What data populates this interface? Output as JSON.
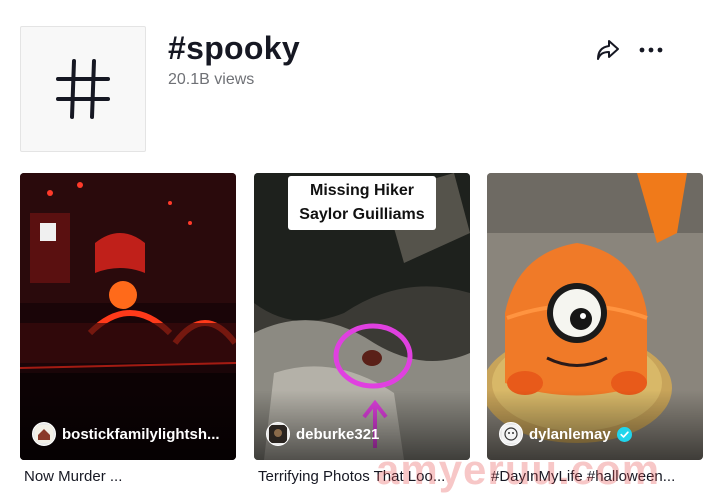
{
  "header": {
    "hashtag_symbol": "#",
    "title": "#spooky",
    "views": "20.1B views"
  },
  "actions": {
    "share_icon": "share-arrow-icon",
    "more_icon": "ellipsis-icon"
  },
  "videos": [
    {
      "author": "bostickfamilylightsh...",
      "caption": "Now Murder ...",
      "avatar_icon": "avatar-house-icon",
      "verified": false
    },
    {
      "author": "deburke321",
      "caption": "Terrifying Photos That Loo...",
      "overlay_text_line1": "Missing Hiker",
      "overlay_text_line2": "Saylor Guilliams",
      "avatar_icon": "avatar-dark-icon",
      "verified": false
    },
    {
      "author": "dylanlemay",
      "caption": "#DayInMyLife #halloween...",
      "avatar_icon": "avatar-cartoon-icon",
      "verified": true
    }
  ],
  "watermark": "amyeruu.com",
  "colors": {
    "verified": "#20d5ec",
    "text_primary": "#161823",
    "text_secondary": "#6f7176"
  }
}
